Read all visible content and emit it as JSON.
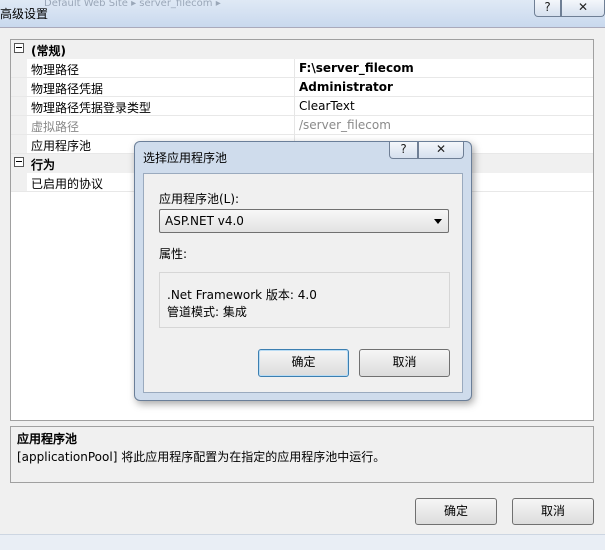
{
  "window": {
    "title": "高级设置",
    "ghost_title": "Default Web Site ▸ server_filecom ▸",
    "help_glyph": "?",
    "close_glyph": "✕"
  },
  "grid": {
    "categories": [
      {
        "label": "(常规)",
        "rows": [
          {
            "name": "物理路径",
            "value": "F:\\server_filecom"
          },
          {
            "name": "物理路径凭据",
            "value": "Administrator"
          },
          {
            "name": "物理路径凭据登录类型",
            "value": "ClearText"
          },
          {
            "name": "虚拟路径",
            "value": "/server_filecom"
          },
          {
            "name": "应用程序池",
            "value": ""
          }
        ]
      },
      {
        "label": "行为",
        "rows": [
          {
            "name": "已启用的协议",
            "value": ""
          }
        ]
      }
    ]
  },
  "description": {
    "title": "应用程序池",
    "text": "[applicationPool] 将此应用程序配置为在指定的应用程序池中运行。"
  },
  "buttons": {
    "ok": "确定",
    "cancel": "取消"
  },
  "dialog": {
    "title": "选择应用程序池",
    "help_glyph": "?",
    "close_glyph": "✕",
    "pool_label": "应用程序池(L):",
    "pool_selected": "ASP.NET v4.0",
    "props_label": "属性:",
    "props_lines": [
      ".Net Framework 版本: 4.0",
      "管道模式: 集成"
    ],
    "ok": "确定",
    "cancel": "取消"
  },
  "colors": {
    "window_bg": "#f0f0f0",
    "titlebar": "#c9d9ee",
    "dialog_frame": "#cfdcec"
  }
}
